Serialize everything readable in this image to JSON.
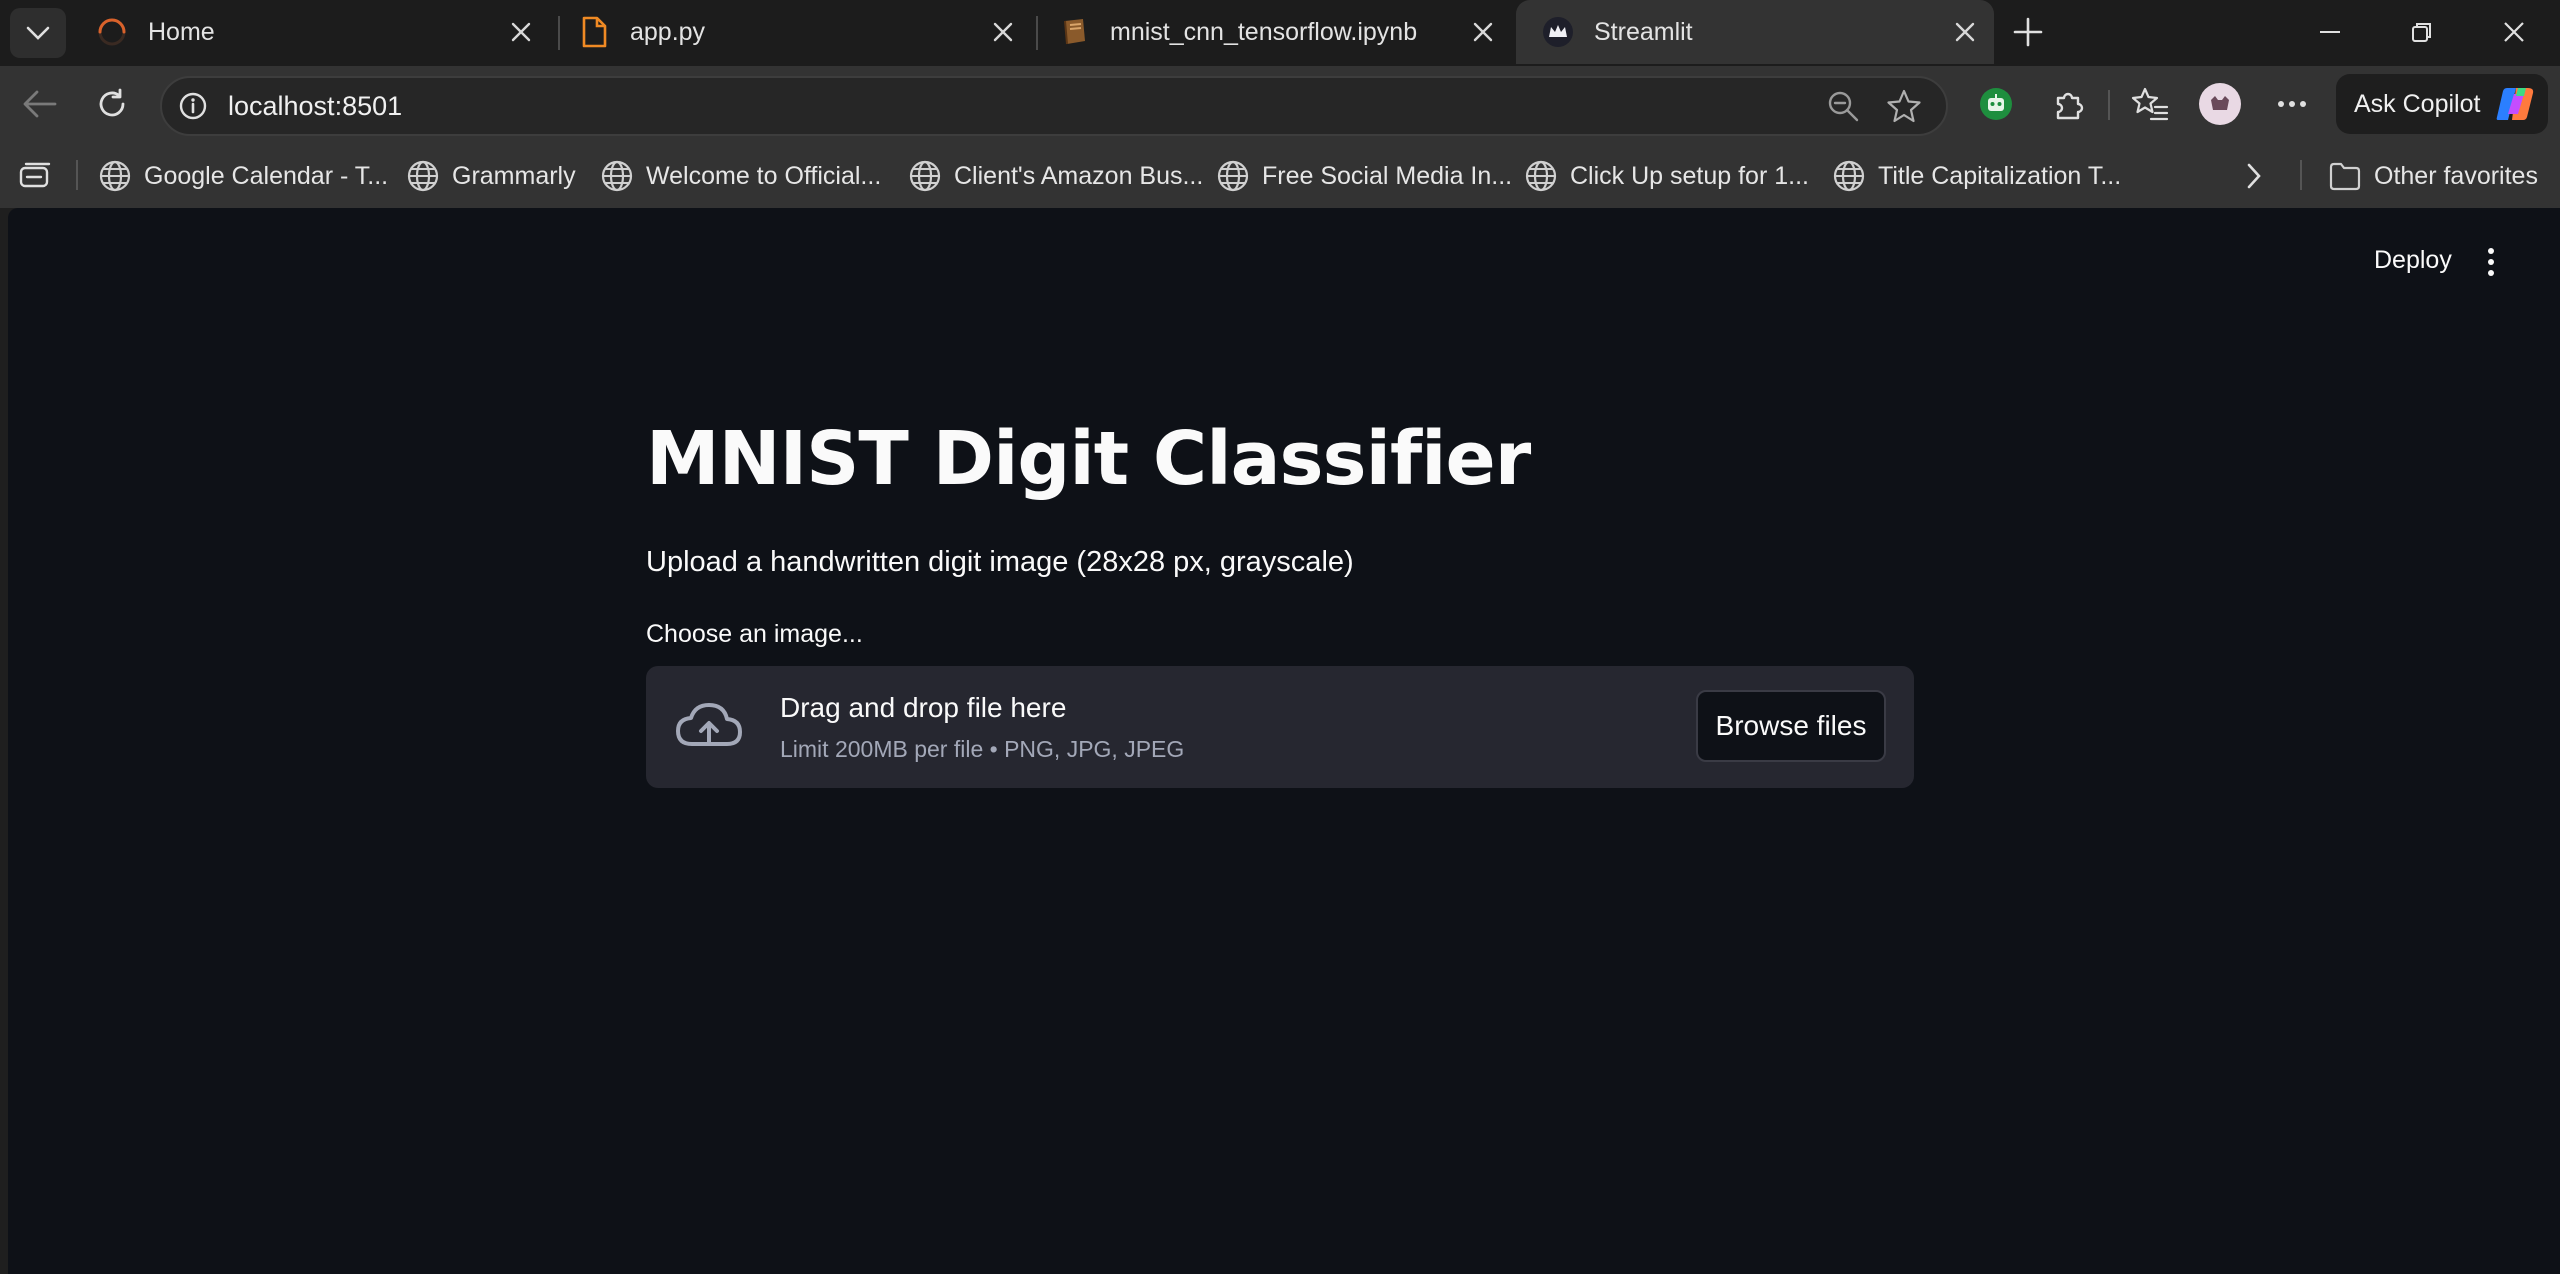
{
  "browser": {
    "tabs": [
      {
        "title": "Home",
        "favicon": "loading-ring-icon"
      },
      {
        "title": "app.py",
        "favicon": "file-icon"
      },
      {
        "title": "mnist_cnn_tensorflow.ipynb",
        "favicon": "notebook-icon"
      },
      {
        "title": "Streamlit",
        "favicon": "streamlit-crown-icon",
        "active": true
      }
    ],
    "address": "localhost:8501",
    "ask_copilot_label": "Ask Copilot",
    "favorites": [
      "Google Calendar - T...",
      "Grammarly",
      "Welcome to Official...",
      "Client's Amazon Bus...",
      "Free Social Media In...",
      "Click Up setup for 1...",
      "Title Capitalization T..."
    ],
    "other_favorites_label": "Other favorites",
    "colors": {
      "tab_strip": "#1c1c1c",
      "toolbar": "#333333",
      "active_tab": "#333333"
    }
  },
  "app": {
    "deploy_label": "Deploy",
    "title": "MNIST Digit Classifier",
    "subtitle": "Upload a handwritten digit image (28x28 px, grayscale)",
    "uploader": {
      "label": "Choose an image...",
      "drag_text": "Drag and drop file here",
      "limit_text": "Limit 200MB per file • PNG, JPG, JPEG",
      "browse_label": "Browse files"
    },
    "colors": {
      "background": "#0e1117",
      "dropzone": "#262730",
      "text": "#fafafa",
      "muted": "#a3a8b8"
    }
  }
}
